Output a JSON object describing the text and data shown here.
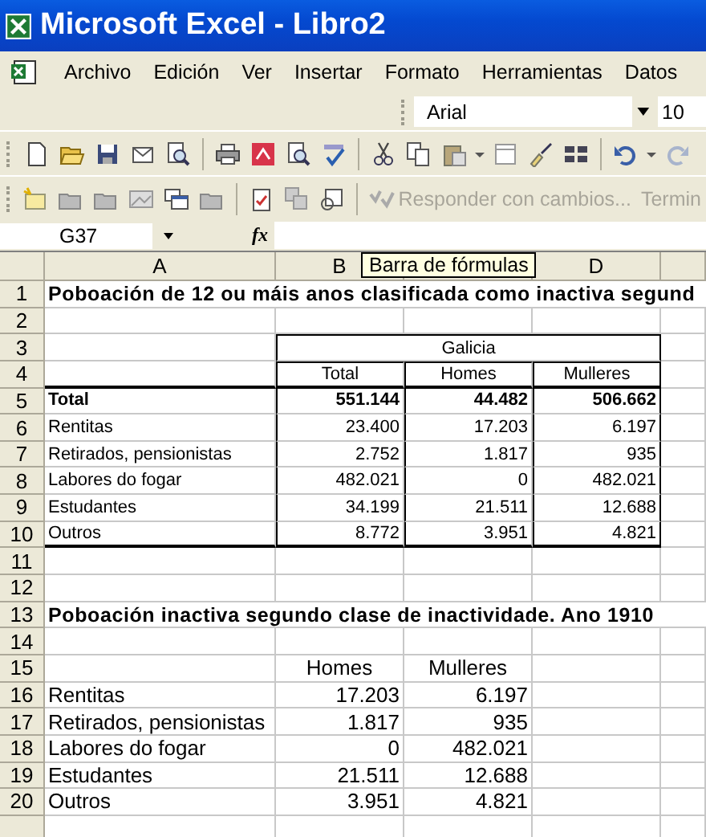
{
  "window": {
    "title": "Microsoft Excel - Libro2"
  },
  "menu": [
    {
      "label": "Archivo"
    },
    {
      "label": "Edición"
    },
    {
      "label": "Ver"
    },
    {
      "label": "Insertar"
    },
    {
      "label": "Formato"
    },
    {
      "label": "Herramientas"
    },
    {
      "label": "Datos"
    }
  ],
  "format_toolbar": {
    "font": "Arial",
    "size": "10"
  },
  "review_toolbar": {
    "reply": "Responder con cambios...",
    "end": "Termin"
  },
  "formula_bar": {
    "name_box": "G37",
    "fx": "fx"
  },
  "column_headers": [
    {
      "label": "A"
    },
    {
      "label": "B"
    },
    {
      "tooltip": "Barra de fórmulas"
    },
    {
      "label": "D"
    }
  ],
  "rows": [
    {
      "n": "1",
      "kind": "title",
      "cells": {
        "A": "Poboación de 12 ou máis anos clasificada como inactiva segund"
      }
    },
    {
      "n": "2",
      "kind": "empty",
      "cells": {}
    },
    {
      "n": "3",
      "kind": "group",
      "cells": {
        "B": "Galicia"
      }
    },
    {
      "n": "4",
      "kind": "head",
      "cells": {
        "B": "Total",
        "C": "Homes",
        "D": "Mulleres"
      }
    },
    {
      "n": "5",
      "kind": "total",
      "cells": {
        "A": "Total",
        "B": "551.144",
        "C": "44.482",
        "D": "506.662"
      }
    },
    {
      "n": "6",
      "kind": "data",
      "cells": {
        "A": "Rentitas",
        "B": "23.400",
        "C": "17.203",
        "D": "6.197"
      }
    },
    {
      "n": "7",
      "kind": "data",
      "cells": {
        "A": "Retirados, pensionistas",
        "B": "2.752",
        "C": "1.817",
        "D": "935"
      }
    },
    {
      "n": "8",
      "kind": "data",
      "cells": {
        "A": "Labores do fogar",
        "B": "482.021",
        "C": "0",
        "D": "482.021"
      }
    },
    {
      "n": "9",
      "kind": "data",
      "cells": {
        "A": "Estudantes",
        "B": "34.199",
        "C": "21.511",
        "D": "12.688"
      }
    },
    {
      "n": "10",
      "kind": "last",
      "cells": {
        "A": "Outros",
        "B": "8.772",
        "C": "3.951",
        "D": "4.821"
      }
    },
    {
      "n": "11",
      "kind": "empty",
      "cells": {}
    },
    {
      "n": "12",
      "kind": "empty",
      "cells": {}
    },
    {
      "n": "13",
      "kind": "title",
      "cells": {
        "A": "Poboación inactiva segundo clase de inactividade. Ano 1910"
      }
    },
    {
      "n": "14",
      "kind": "empty",
      "cells": {}
    },
    {
      "n": "15",
      "kind": "plainhead",
      "cells": {
        "B": "Homes",
        "C": "Mulleres"
      }
    },
    {
      "n": "16",
      "kind": "plain",
      "cells": {
        "A": "Rentitas",
        "B": "17.203",
        "C": "6.197"
      }
    },
    {
      "n": "17",
      "kind": "plain",
      "cells": {
        "A": "Retirados, pensionistas",
        "B": "1.817",
        "C": "935"
      }
    },
    {
      "n": "18",
      "kind": "plain",
      "cells": {
        "A": "Labores do fogar",
        "B": "0",
        "C": "482.021"
      }
    },
    {
      "n": "19",
      "kind": "plain",
      "cells": {
        "A": "Estudantes",
        "B": "21.511",
        "C": "12.688"
      }
    },
    {
      "n": "20",
      "kind": "plain",
      "cells": {
        "A": "Outros",
        "B": "3.951",
        "C": "4.821"
      }
    }
  ]
}
